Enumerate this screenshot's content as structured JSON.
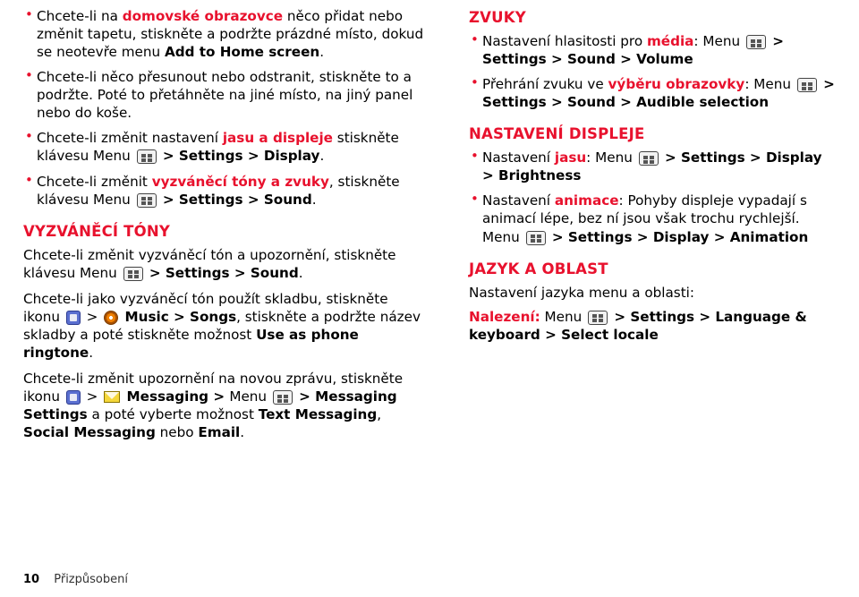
{
  "footer": {
    "page_number": "10",
    "section": "Přizpůsobení"
  },
  "left_column": {
    "bullets_top": [
      {
        "id": "home-screen-add",
        "parts": [
          {
            "t": "text",
            "v": "Chcete-li na "
          },
          {
            "t": "red",
            "v": "domovské obrazovce"
          },
          {
            "t": "text",
            "v": " něco přidat nebo změnit tapetu, stiskněte a podržte prázdné místo, dokud se neotevře menu "
          },
          {
            "t": "bold",
            "v": "Add to Home screen"
          },
          {
            "t": "text",
            "v": "."
          }
        ]
      },
      {
        "id": "move-remove",
        "parts": [
          {
            "t": "text",
            "v": "Chcete-li něco přesunout nebo odstranit, stiskněte to a podržte. Poté to přetáhněte na jiné místo, na jiný panel nebo do koše."
          }
        ]
      },
      {
        "id": "brightness-display",
        "parts": [
          {
            "t": "text",
            "v": "Chcete-li změnit nastavení "
          },
          {
            "t": "red",
            "v": "jasu a displeje"
          },
          {
            "t": "text",
            "v": " stiskněte klávesu Menu "
          },
          {
            "t": "icon",
            "v": "menu-icon"
          },
          {
            "t": "bold",
            "v": " > Settings > Display"
          },
          {
            "t": "text",
            "v": "."
          }
        ]
      },
      {
        "id": "ringtones-sounds",
        "parts": [
          {
            "t": "text",
            "v": "Chcete-li změnit "
          },
          {
            "t": "red",
            "v": "vyzváněcí tóny a zvuky"
          },
          {
            "t": "text",
            "v": ", stiskněte klávesu Menu "
          },
          {
            "t": "icon",
            "v": "menu-icon"
          },
          {
            "t": "bold",
            "v": " > Settings > Sound"
          },
          {
            "t": "text",
            "v": "."
          }
        ]
      }
    ],
    "heading_ringtones": "VYZVÁNĚCÍ TÓNY",
    "paras": [
      {
        "id": "change-ringtone-notification",
        "parts": [
          {
            "t": "text",
            "v": "Chcete-li změnit vyzváněcí tón a upozornění, stiskněte klávesu Menu "
          },
          {
            "t": "icon",
            "v": "menu-icon"
          },
          {
            "t": "bold",
            "v": " > Settings > Sound"
          },
          {
            "t": "text",
            "v": "."
          }
        ]
      },
      {
        "id": "song-as-ringtone",
        "parts": [
          {
            "t": "text",
            "v": "Chcete-li jako vyzváněcí tón použít skladbu, stiskněte ikonu "
          },
          {
            "t": "icon",
            "v": "launcher-icon"
          },
          {
            "t": "text",
            "v": " > "
          },
          {
            "t": "icon",
            "v": "music-icon"
          },
          {
            "t": "bold",
            "v": " Music > Songs"
          },
          {
            "t": "text",
            "v": ", stiskněte a podržte název skladby a poté stiskněte možnost "
          },
          {
            "t": "bold",
            "v": "Use as phone ringtone"
          },
          {
            "t": "text",
            "v": "."
          }
        ]
      },
      {
        "id": "message-notification",
        "parts": [
          {
            "t": "text",
            "v": "Chcete-li změnit upozornění na novou zprávu, stiskněte ikonu "
          },
          {
            "t": "icon",
            "v": "launcher-icon"
          },
          {
            "t": "text",
            "v": " > "
          },
          {
            "t": "icon",
            "v": "mail-icon"
          },
          {
            "t": "bold",
            "v": " Messaging > "
          },
          {
            "t": "text",
            "v": "Menu "
          },
          {
            "t": "icon",
            "v": "menu-icon"
          },
          {
            "t": "bold",
            "v": " > Messaging Settings"
          },
          {
            "t": "text",
            "v": " a poté vyberte možnost "
          },
          {
            "t": "bold",
            "v": "Text Messaging"
          },
          {
            "t": "text",
            "v": ", "
          },
          {
            "t": "bold",
            "v": "Social Messaging"
          },
          {
            "t": "text",
            "v": " nebo "
          },
          {
            "t": "bold",
            "v": "Email"
          },
          {
            "t": "text",
            "v": "."
          }
        ]
      }
    ]
  },
  "right_column": {
    "heading_sounds": "ZVUKY",
    "sound_bullets": [
      {
        "id": "media-volume",
        "parts": [
          {
            "t": "text",
            "v": "Nastavení hlasitosti pro "
          },
          {
            "t": "red",
            "v": "média"
          },
          {
            "t": "text",
            "v": ": Menu "
          },
          {
            "t": "icon",
            "v": "menu-icon"
          },
          {
            "t": "bold",
            "v": " > Settings > Sound > Volume"
          }
        ]
      },
      {
        "id": "screen-selection-sound",
        "parts": [
          {
            "t": "text",
            "v": "Přehrání zvuku ve "
          },
          {
            "t": "red",
            "v": "výběru obrazovky"
          },
          {
            "t": "text",
            "v": ": Menu "
          },
          {
            "t": "icon",
            "v": "menu-icon"
          },
          {
            "t": "bold",
            "v": " > Settings > Sound > Audible selection"
          }
        ]
      }
    ],
    "heading_display": "NASTAVENÍ DISPLEJE",
    "display_bullets": [
      {
        "id": "brightness",
        "parts": [
          {
            "t": "text",
            "v": "Nastavení "
          },
          {
            "t": "red",
            "v": "jasu"
          },
          {
            "t": "text",
            "v": ": Menu "
          },
          {
            "t": "icon",
            "v": "menu-icon"
          },
          {
            "t": "bold",
            "v": " > Settings > Display > Brightness"
          }
        ]
      },
      {
        "id": "animation",
        "parts": [
          {
            "t": "text",
            "v": "Nastavení "
          },
          {
            "t": "red",
            "v": "animace"
          },
          {
            "t": "text",
            "v": ": Pohyby displeje vypadají s animací lépe, bez ní jsou však trochu rychlejší. Menu "
          },
          {
            "t": "icon",
            "v": "menu-icon"
          },
          {
            "t": "bold",
            "v": " > Settings > Display > Animation"
          }
        ]
      }
    ],
    "heading_language": "JAZYK A OBLAST",
    "language_intro": "Nastavení jazyka menu a oblasti:",
    "language_line": {
      "id": "locale-path",
      "parts": [
        {
          "t": "red",
          "v": "Nalezení:"
        },
        {
          "t": "text",
          "v": " Menu "
        },
        {
          "t": "icon",
          "v": "menu-icon"
        },
        {
          "t": "bold",
          "v": " > Settings > Language & keyboard > Select locale"
        }
      ]
    }
  }
}
